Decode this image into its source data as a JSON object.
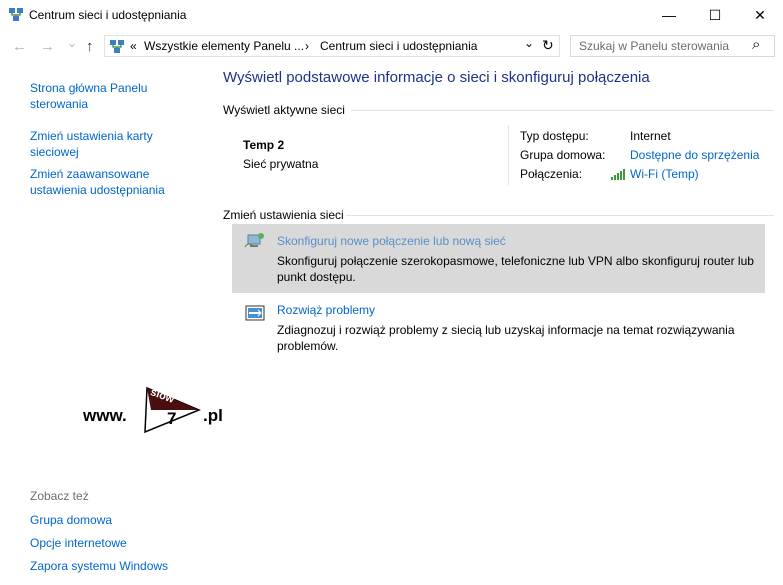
{
  "window": {
    "title": "Centrum sieci i udostępniania",
    "minimize_glyph": "—",
    "maximize_glyph": "☐",
    "close_glyph": "✕"
  },
  "address": {
    "back_glyph": "←",
    "forward_glyph": "→",
    "history_glyph": "⌄",
    "up_glyph": "↑",
    "overflow": "«",
    "crumb1": "Wszystkie elementy Panelu ...",
    "sep": "›",
    "crumb2": "Centrum sieci i udostępniania",
    "dropdown_glyph": "⌄",
    "refresh_glyph": "↻",
    "search_placeholder": "Szukaj w Panelu sterowania",
    "search_glyph": "⌕"
  },
  "sidebar": {
    "home_line1": "Strona główna Panelu",
    "home_line2": "sterowania",
    "adapter_line1": "Zmień ustawienia karty",
    "adapter_line2": "sieciowej",
    "sharing_line1": "Zmień zaawansowane",
    "sharing_line2": "ustawienia udostępniania",
    "see_also": "Zobacz też",
    "link1": "Grupa domowa",
    "link2": "Opcje internetowe",
    "link3": "Zapora systemu Windows"
  },
  "main": {
    "title": "Wyświetl podstawowe informacje o sieci i skonfiguruj połączenia",
    "active_header": "Wyświetl aktywne sieci",
    "network_name": "Temp 2",
    "network_type": "Sieć prywatna",
    "access_label": "Typ dostępu:",
    "access_value": "Internet",
    "homegroup_label": "Grupa domowa:",
    "homegroup_value": "Dostępne do sprzężenia",
    "connections_label": "Połączenia:",
    "connections_value": "Wi-Fi (Temp)",
    "change_header": "Zmień ustawienia sieci",
    "setup_title": "Skonfiguruj nowe połączenie lub nową sieć",
    "setup_desc1": "Skonfiguruj połączenie szerokopasmowe, telefoniczne lub VPN albo skonfiguruj router lub",
    "setup_desc2": "punkt dostępu.",
    "trouble_title": "Rozwiąż problemy",
    "trouble_desc1": "Zdiagnozuj i rozwiąż problemy z siecią lub uzyskaj informacje na temat rozwiązywania",
    "trouble_desc2": "problemów."
  },
  "watermark": {
    "prefix": "www.",
    "word": "slow",
    "digit": "7",
    "suffix": ".pl"
  },
  "colors": {
    "link": "#0066cc",
    "title": "#1e3287",
    "card": "#d9d9d9",
    "watermark_dark": "#4a0e0e"
  }
}
